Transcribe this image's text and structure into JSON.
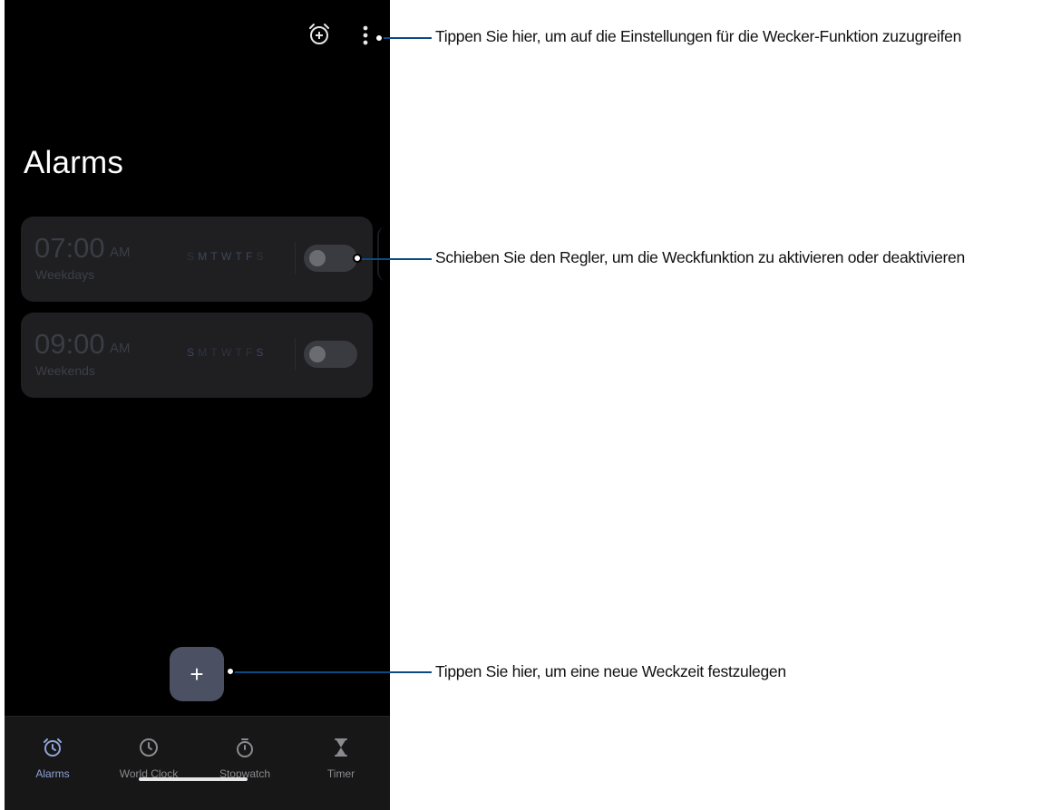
{
  "screen": {
    "title": "Alarms",
    "header_icons": [
      "alarm-add-icon",
      "more-vert-icon"
    ],
    "alarms": [
      {
        "time": "07:00",
        "ampm": "AM",
        "label": "Weekdays",
        "days": [
          "S",
          "M",
          "T",
          "W",
          "T",
          "F",
          "S"
        ],
        "active_days": [
          false,
          true,
          true,
          true,
          true,
          true,
          false
        ],
        "enabled": false
      },
      {
        "time": "09:00",
        "ampm": "AM",
        "label": "Weekends",
        "days": [
          "S",
          "M",
          "T",
          "W",
          "T",
          "F",
          "S"
        ],
        "active_days": [
          true,
          false,
          false,
          false,
          false,
          false,
          true
        ],
        "enabled": false
      }
    ],
    "fab_label": "+",
    "nav": [
      {
        "label": "Alarms",
        "icon": "alarm-icon",
        "active": true
      },
      {
        "label": "World Clock",
        "icon": "clock-icon",
        "active": false
      },
      {
        "label": "Stopwatch",
        "icon": "stopwatch-icon",
        "active": false
      },
      {
        "label": "Timer",
        "icon": "hourglass-icon",
        "active": false
      }
    ]
  },
  "callouts": [
    {
      "text": "Tippen Sie hier, um auf die Einstellungen für die Wecker-Funktion zuzugreifen"
    },
    {
      "text": "Schieben Sie den Regler, um die Weckfunktion zu aktivieren oder deaktivieren"
    },
    {
      "text": "Tippen Sie hier, um eine neue Weckzeit festzulegen"
    }
  ],
  "colors": {
    "callout_line": "#0b4a86",
    "accent": "#8fa3d8",
    "fab": "#4b5163"
  }
}
